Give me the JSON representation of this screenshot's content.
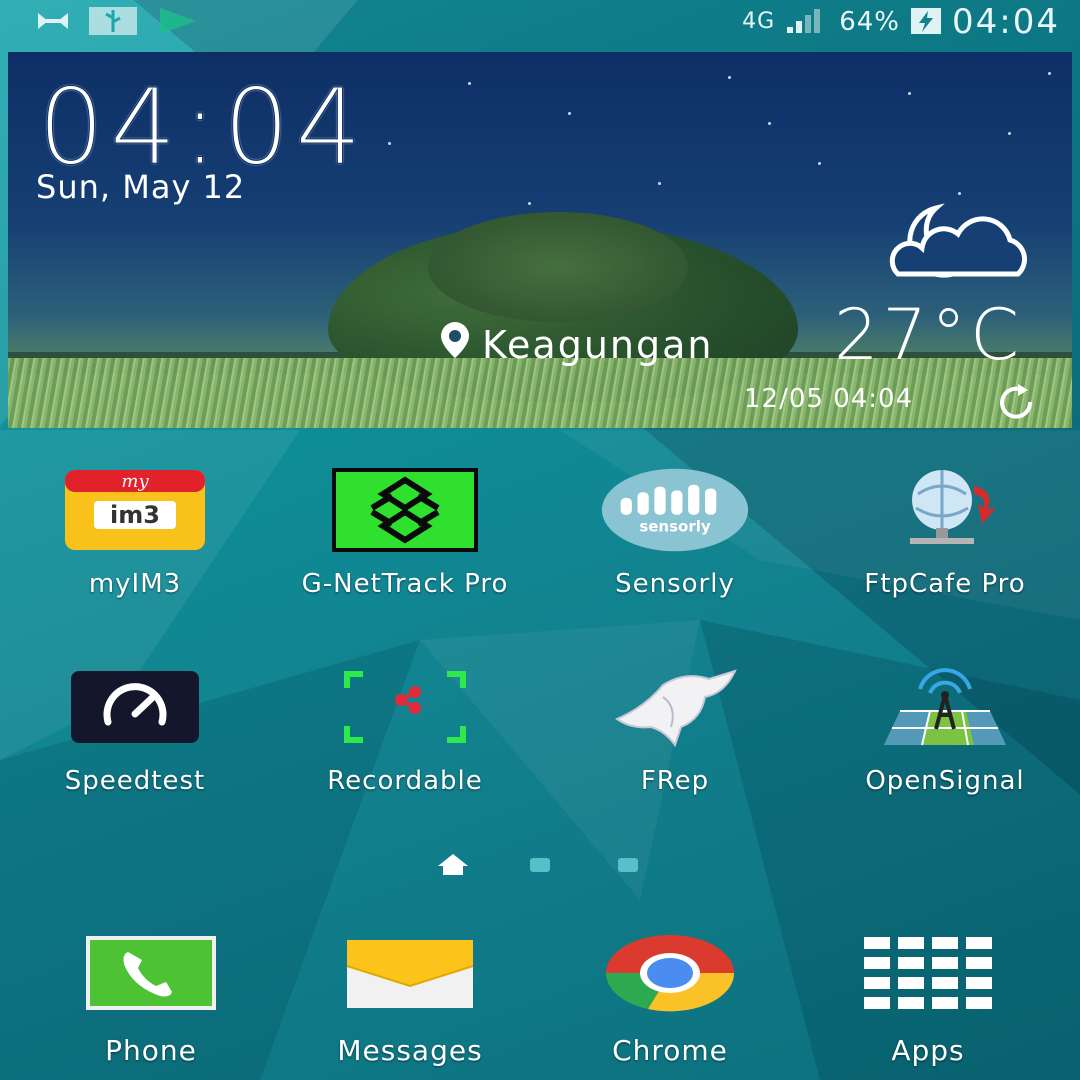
{
  "status_bar": {
    "network_type": "4G",
    "battery_percent": "64%",
    "time": "04:04",
    "left_icons": [
      "usb-icon",
      "usb-debug-icon",
      "play-store-icon"
    ]
  },
  "clock_widget": {
    "time": "04:04",
    "date": "Sun, May 12",
    "location": "Keagungan",
    "temperature": "27°C",
    "updated": "12/05 04:04",
    "weather_condition_icon": "moon-cloud-icon"
  },
  "apps": [
    {
      "label": "myIM3",
      "icon": "myim3-icon"
    },
    {
      "label": "G-NetTrack Pro",
      "icon": "gnettrack-icon"
    },
    {
      "label": "Sensorly",
      "icon": "sensorly-icon"
    },
    {
      "label": "FtpCafe Pro",
      "icon": "ftpcafe-icon"
    },
    {
      "label": "Speedtest",
      "icon": "speedtest-icon"
    },
    {
      "label": "Recordable",
      "icon": "recordable-icon"
    },
    {
      "label": "FRep",
      "icon": "frep-icon"
    },
    {
      "label": "OpenSignal",
      "icon": "opensignal-icon"
    }
  ],
  "pager": {
    "pages": 3,
    "current": "home"
  },
  "dock": [
    {
      "label": "Phone",
      "icon": "phone-icon"
    },
    {
      "label": "Messages",
      "icon": "messages-icon"
    },
    {
      "label": "Chrome",
      "icon": "chrome-icon"
    },
    {
      "label": "Apps",
      "icon": "apps-grid-icon"
    }
  ],
  "colors": {
    "wallpaper": "#12818e",
    "accent": "#5ec7cf"
  }
}
